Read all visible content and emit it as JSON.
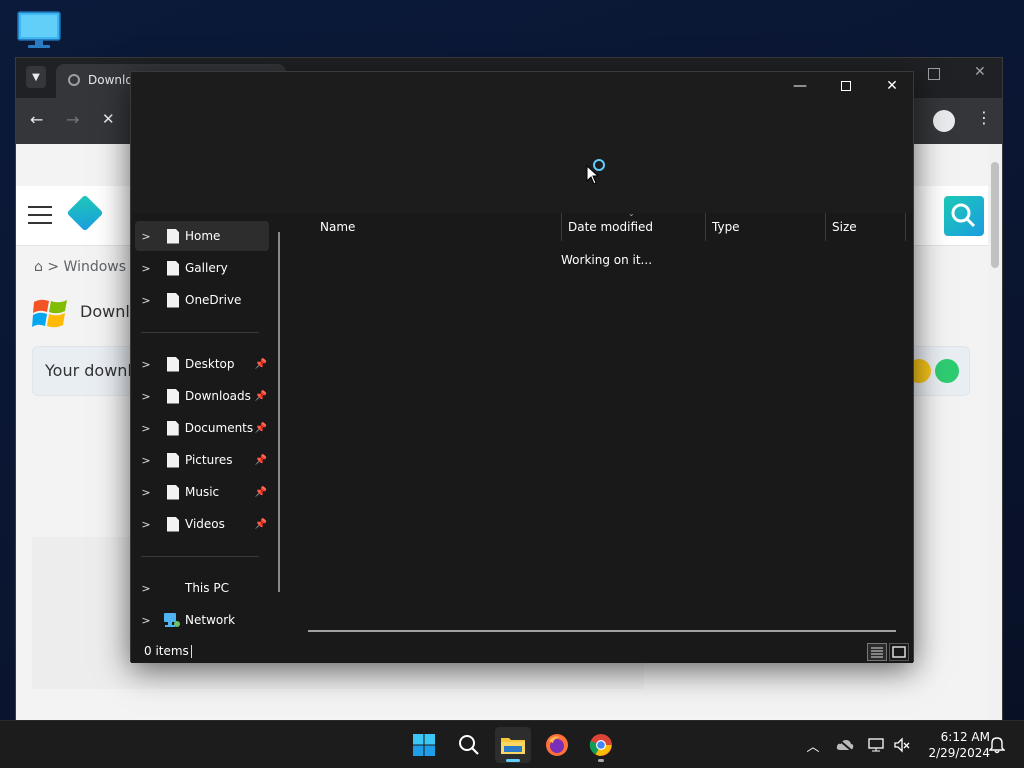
{
  "browser": {
    "tab_title": "Downlo",
    "breadcrumb": "Windows",
    "page_heading": "Downlo",
    "download_notice": "Your downl"
  },
  "explorer": {
    "nav": {
      "quick": [
        {
          "label": "Home",
          "selected": true
        },
        {
          "label": "Gallery"
        },
        {
          "label": "OneDrive"
        }
      ],
      "pinned": [
        {
          "label": "Desktop"
        },
        {
          "label": "Downloads"
        },
        {
          "label": "Documents"
        },
        {
          "label": "Pictures"
        },
        {
          "label": "Music"
        },
        {
          "label": "Videos"
        }
      ],
      "devices": [
        {
          "label": "This PC"
        },
        {
          "label": "Network"
        }
      ]
    },
    "columns": [
      "Name",
      "Date modified",
      "Type",
      "Size"
    ],
    "loading_text": "Working on it...",
    "status": "0 items"
  },
  "taskbar": {
    "time": "6:12 AM",
    "date": "2/29/2024"
  },
  "colors": {
    "accent": "#60cdff",
    "explorer_bg": "#191919",
    "taskbar_bg": "#1c1c1c"
  }
}
